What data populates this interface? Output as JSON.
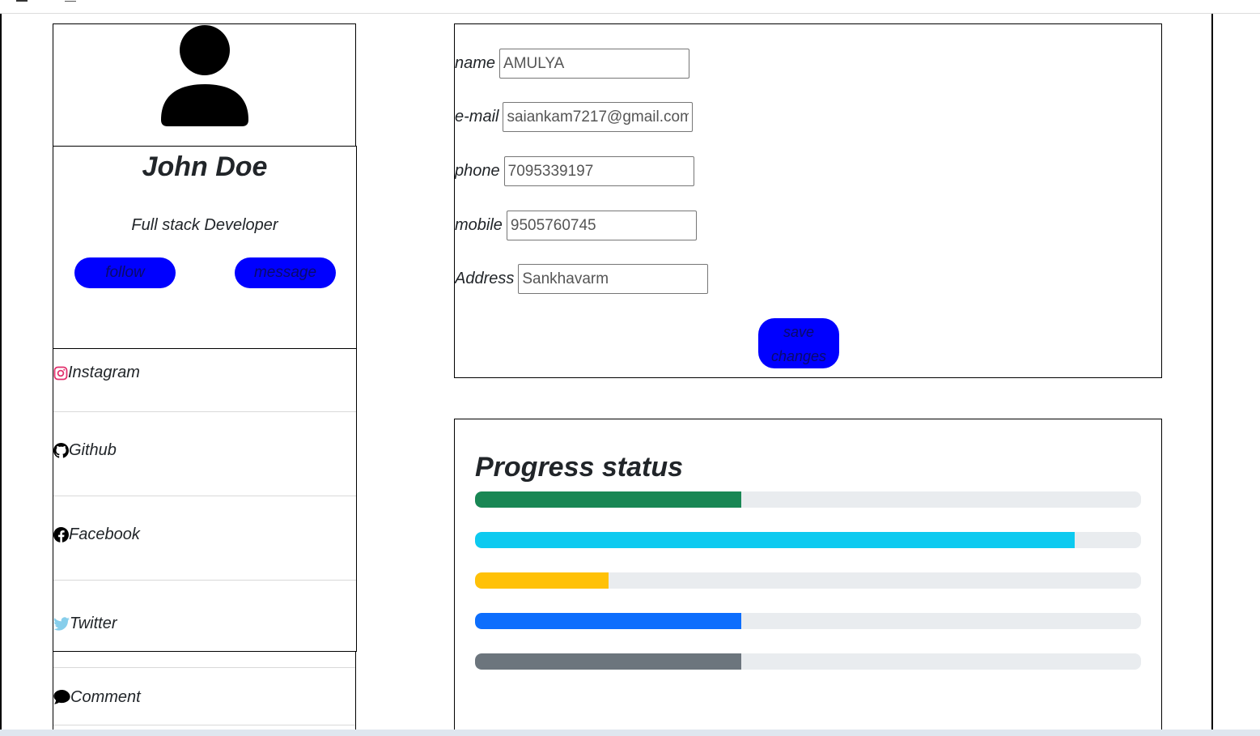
{
  "profile": {
    "name": "John Doe",
    "role": "Full stack Developer",
    "follow_label": "follow",
    "message_label": "message"
  },
  "social": [
    {
      "label": "Instagram",
      "icon": "instagram-icon",
      "color": "#e1306c"
    },
    {
      "label": "Github",
      "icon": "github-icon",
      "color": "#000000"
    },
    {
      "label": "Facebook",
      "icon": "facebook-icon",
      "color": "#000000"
    },
    {
      "label": "Twitter",
      "icon": "twitter-icon",
      "color": "#87ceeb"
    }
  ],
  "comment": {
    "label": "Comment",
    "icon": "comment-icon"
  },
  "form": {
    "name_label": "name",
    "name_value": "AMULYA",
    "email_label": "e-mail",
    "email_value": "saiankam7217@gmail.com",
    "phone_label": "phone",
    "phone_value": "7095339197",
    "mobile_label": "mobile",
    "mobile_value": "9505760745",
    "address_label": "Address",
    "address_value": "Sankhavarm",
    "save_label": "save changes"
  },
  "progress": {
    "title": "Progress status",
    "bars": [
      {
        "percent": 40,
        "color": "#198754"
      },
      {
        "percent": 90,
        "color": "#0dcaf0"
      },
      {
        "percent": 20,
        "color": "#ffc107"
      },
      {
        "percent": 40,
        "color": "#0d6efd"
      },
      {
        "percent": 40,
        "color": "#6c757d"
      }
    ]
  },
  "colors": {
    "accent_button": "#0000ff"
  }
}
